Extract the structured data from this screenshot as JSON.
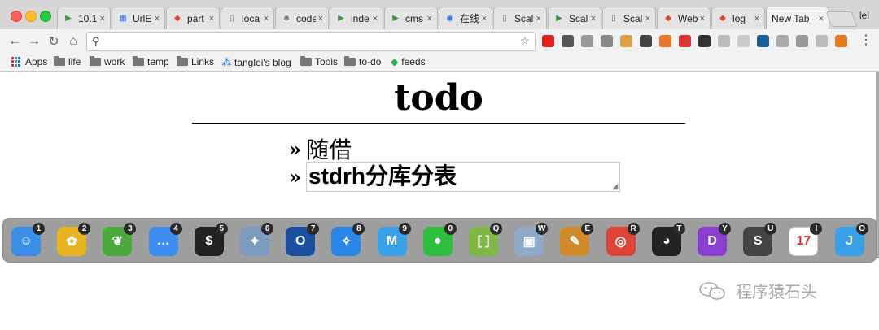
{
  "browser": {
    "tabs": [
      {
        "label": "10.1",
        "icon": "play-icon",
        "color": "#3a9b3a"
      },
      {
        "label": "UrlE",
        "icon": "page-icon",
        "color": "#2a6fd6"
      },
      {
        "label": "part",
        "icon": "gitlab-icon",
        "color": "#e2432a"
      },
      {
        "label": "loca",
        "icon": "document-icon",
        "color": "#777777"
      },
      {
        "label": "code",
        "icon": "avatar-icon",
        "color": "#8a7a5a"
      },
      {
        "label": "inde",
        "icon": "play-icon",
        "color": "#3a9b3a"
      },
      {
        "label": "cms",
        "icon": "play-icon",
        "color": "#3a9b3a"
      },
      {
        "label": "在线",
        "icon": "globe-icon",
        "color": "#2a7ad6"
      },
      {
        "label": "Scal",
        "icon": "document-icon",
        "color": "#777777"
      },
      {
        "label": "Scal",
        "icon": "play-icon",
        "color": "#3a9b3a"
      },
      {
        "label": "Scal",
        "icon": "document-icon",
        "color": "#777777"
      },
      {
        "label": "Web",
        "icon": "gitlab-icon",
        "color": "#e2432a"
      },
      {
        "label": "log",
        "icon": "gitlab-icon",
        "color": "#e2432a"
      },
      {
        "label": "New Tab",
        "icon": "",
        "color": "#ffffff",
        "active": true
      }
    ],
    "tab_close": "×",
    "profile": "lei",
    "omnibox": {
      "value": ""
    },
    "extensions": [
      {
        "name": "opera-icon",
        "color": "#d22"
      },
      {
        "name": "evernote-icon",
        "color": "#555"
      },
      {
        "name": "pocket-icon",
        "color": "#999"
      },
      {
        "name": "compass-icon",
        "color": "#888"
      },
      {
        "name": "cookie-icon",
        "color": "#d9a04a"
      },
      {
        "name": "mask-icon",
        "color": "#444"
      },
      {
        "name": "translate-icon",
        "color": "#e9762b"
      },
      {
        "name": "cross-icon",
        "color": "#d33"
      },
      {
        "name": "sprite-icon",
        "color": "#333"
      },
      {
        "name": "circle-icon",
        "color": "#bbb"
      },
      {
        "name": "tex-icon",
        "color": "#ccc"
      },
      {
        "name": "m-icon",
        "color": "#1a5f9a"
      },
      {
        "name": "shield-icon",
        "color": "#aaa"
      },
      {
        "name": "check-icon",
        "color": "#999"
      },
      {
        "name": "leaf-icon",
        "color": "#bbb"
      },
      {
        "name": "stop-icon",
        "color": "#e67a1e"
      }
    ]
  },
  "bookmarks": [
    {
      "label": "Apps",
      "type": "apps"
    },
    {
      "label": "life",
      "type": "folder"
    },
    {
      "label": "work",
      "type": "folder"
    },
    {
      "label": "temp",
      "type": "folder"
    },
    {
      "label": "Links",
      "type": "folder"
    },
    {
      "label": "tanglei's blog",
      "type": "site"
    },
    {
      "label": "Tools",
      "type": "folder"
    },
    {
      "label": "to-do",
      "type": "folder"
    },
    {
      "label": "feeds",
      "type": "feeds"
    }
  ],
  "page": {
    "title": "todo",
    "bullet": "»",
    "items": [
      "随借"
    ],
    "input_value": "stdrh分库分表"
  },
  "dock": [
    {
      "name": "finder",
      "badge": "1",
      "color": "#3a8ee6",
      "glyph": "☺"
    },
    {
      "name": "sunflower",
      "badge": "2",
      "color": "#e8b321",
      "glyph": "✿"
    },
    {
      "name": "evernote",
      "badge": "3",
      "color": "#4caa3c",
      "glyph": "❦"
    },
    {
      "name": "messages",
      "badge": "4",
      "color": "#3d8ef0",
      "glyph": "…"
    },
    {
      "name": "terminal",
      "badge": "5",
      "color": "#222222",
      "glyph": "$"
    },
    {
      "name": "preview",
      "badge": "6",
      "color": "#7c9bbf",
      "glyph": "✦"
    },
    {
      "name": "opera",
      "badge": "7",
      "color": "#1b4fa0",
      "glyph": "O"
    },
    {
      "name": "safari",
      "badge": "8",
      "color": "#2a86e8",
      "glyph": "✧"
    },
    {
      "name": "markdown",
      "badge": "9",
      "color": "#3aa3e8",
      "glyph": "M"
    },
    {
      "name": "wechat",
      "badge": "0",
      "color": "#2fbf3f",
      "glyph": "●"
    },
    {
      "name": "brackets",
      "badge": "Q",
      "color": "#7fb844",
      "glyph": "[ ]"
    },
    {
      "name": "photos",
      "badge": "W",
      "color": "#8faac8",
      "glyph": "▣"
    },
    {
      "name": "instruments",
      "badge": "E",
      "color": "#d08a2a",
      "glyph": "✎"
    },
    {
      "name": "chrome",
      "badge": "R",
      "color": "#db4437",
      "glyph": "◎"
    },
    {
      "name": "qq",
      "badge": "T",
      "color": "#222222",
      "glyph": "◕"
    },
    {
      "name": "dash",
      "badge": "Y",
      "color": "#8a3fd1",
      "glyph": "D"
    },
    {
      "name": "sublime",
      "badge": "U",
      "color": "#444444",
      "glyph": "S"
    },
    {
      "name": "calendar",
      "badge": "I",
      "color": "#ffffff",
      "glyph": "17"
    },
    {
      "name": "intellij",
      "badge": "O",
      "color": "#3aa0e8",
      "glyph": "J"
    }
  ],
  "watermark": "程序猿石头"
}
